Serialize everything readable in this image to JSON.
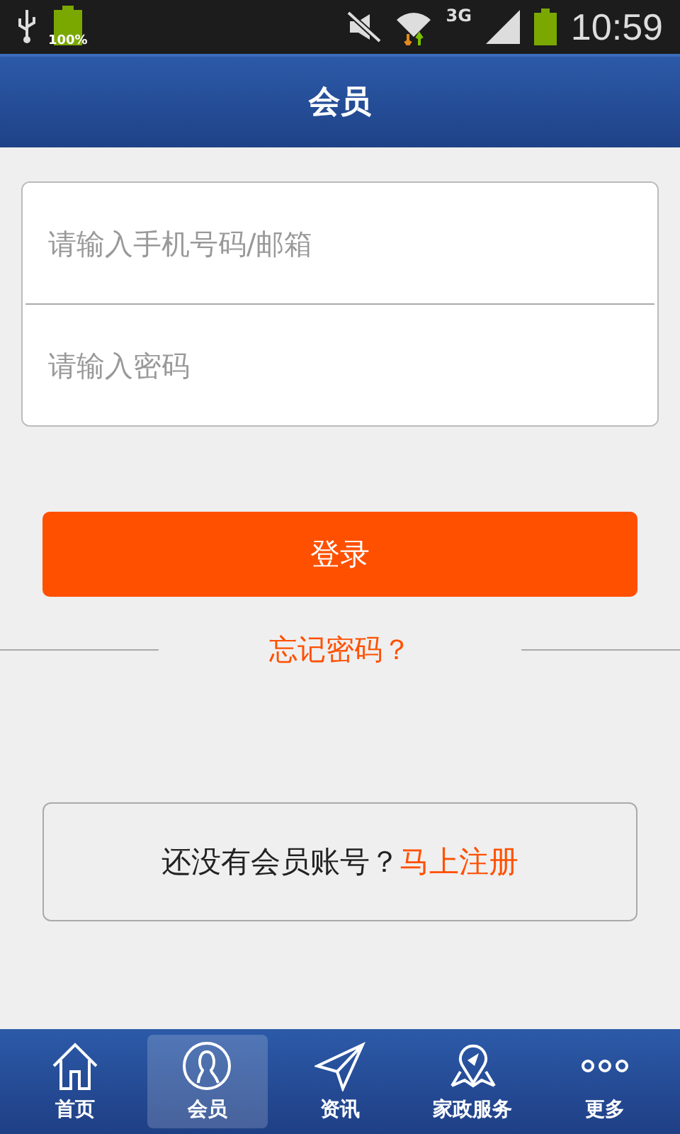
{
  "status_bar": {
    "battery_label": "100%",
    "network": "3G",
    "time": "10:59"
  },
  "header": {
    "title": "会员"
  },
  "form": {
    "fields": [
      {
        "placeholder": "请输入手机号码/邮箱"
      },
      {
        "placeholder": "请输入密码"
      }
    ],
    "login_button": "登录",
    "forgot_link": "忘记密码？"
  },
  "register": {
    "prompt": "还没有会员账号？",
    "link": "马上注册"
  },
  "tabs": [
    {
      "kind": "home",
      "label": "首页",
      "selected": false
    },
    {
      "kind": "member",
      "label": "会员",
      "selected": true
    },
    {
      "kind": "news",
      "label": "资讯",
      "selected": false
    },
    {
      "kind": "service",
      "label": "家政服务",
      "selected": false
    },
    {
      "kind": "more",
      "label": "更多",
      "selected": false
    }
  ]
}
